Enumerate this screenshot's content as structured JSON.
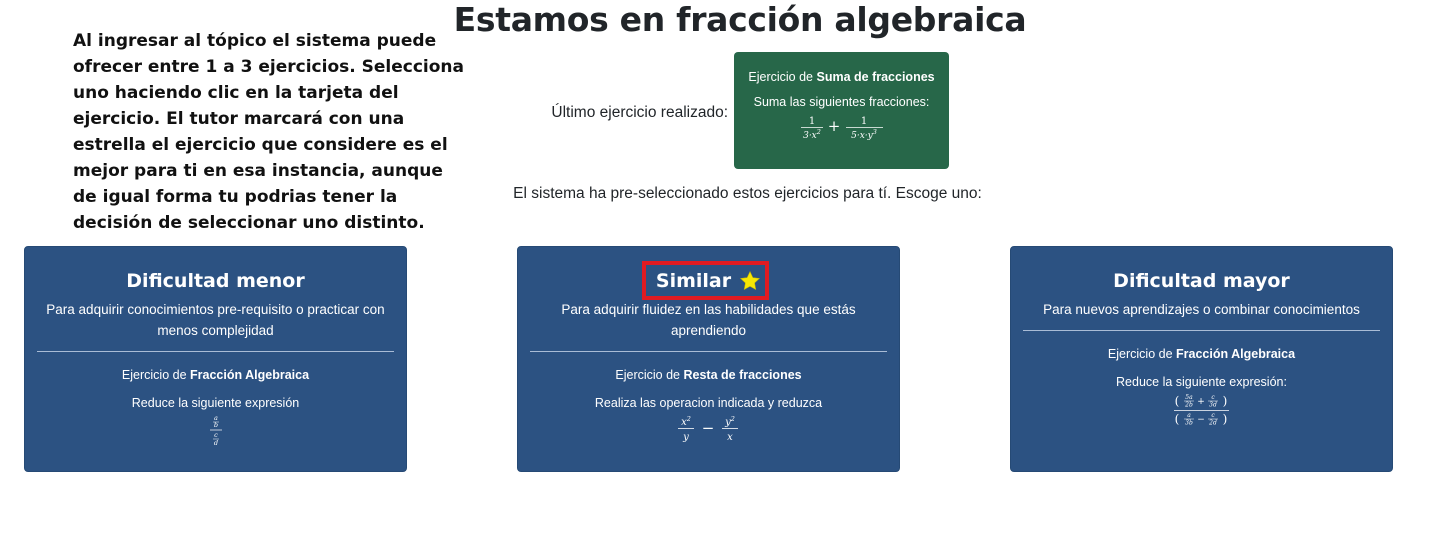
{
  "page": {
    "title": "Estamos en fracción algebraica",
    "instructions": "Al ingresar al tópico el sistema puede ofrecer entre 1 a 3 ejercicios. Selecciona uno haciendo clic en la tarjeta del ejercicio. El tutor marcará con una estrella el ejercicio que considere es el mejor para ti en esa instancia, aunque de igual forma tu podrias tener la decisión de seleccionar uno distinto."
  },
  "last_exercise": {
    "label": "Último ejercicio realizado:",
    "prefix": "Ejercicio de",
    "topic": "Suma de fracciones",
    "instruction": "Suma las siguientes fracciones:",
    "expression": "1/(3·x²) + 1/(5·x·y³)"
  },
  "choose_text": "El sistema ha pre-seleccionado estos ejercicios para tí. Escoge uno:",
  "cards": [
    {
      "title": "Dificultad menor",
      "description": "Para adquirir conocimientos pre-requisito o practicar con menos complejidad",
      "prefix": "Ejercicio de",
      "topic": "Fracción Algebraica",
      "instruction": "Reduce la siguiente expresión",
      "expression": "(a/b)/(c/d)",
      "recommended": false
    },
    {
      "title": "Similar",
      "description": "Para adquirir fluidez en las habilidades que estás aprendiendo",
      "prefix": "Ejercicio de",
      "topic": "Resta de fracciones",
      "instruction": "Realiza las operacion indicada y reduzca",
      "expression": "x²/y − y²/x",
      "recommended": true,
      "star_icon": "star-icon",
      "star_color": "#f6e805"
    },
    {
      "title": "Dificultad mayor",
      "description": "Para nuevos aprendizajes o combinar conocimientos",
      "prefix": "Ejercicio de",
      "topic": "Fracción Algebraica",
      "instruction": "Reduce la siguiente expresión:",
      "expression": "(5a/2b + c/3d)/(a/3b − c/2d)",
      "recommended": false
    }
  ],
  "colors": {
    "last_card_bg": "#276749",
    "card_bg": "#2c5282",
    "highlight": "#e11b22"
  }
}
